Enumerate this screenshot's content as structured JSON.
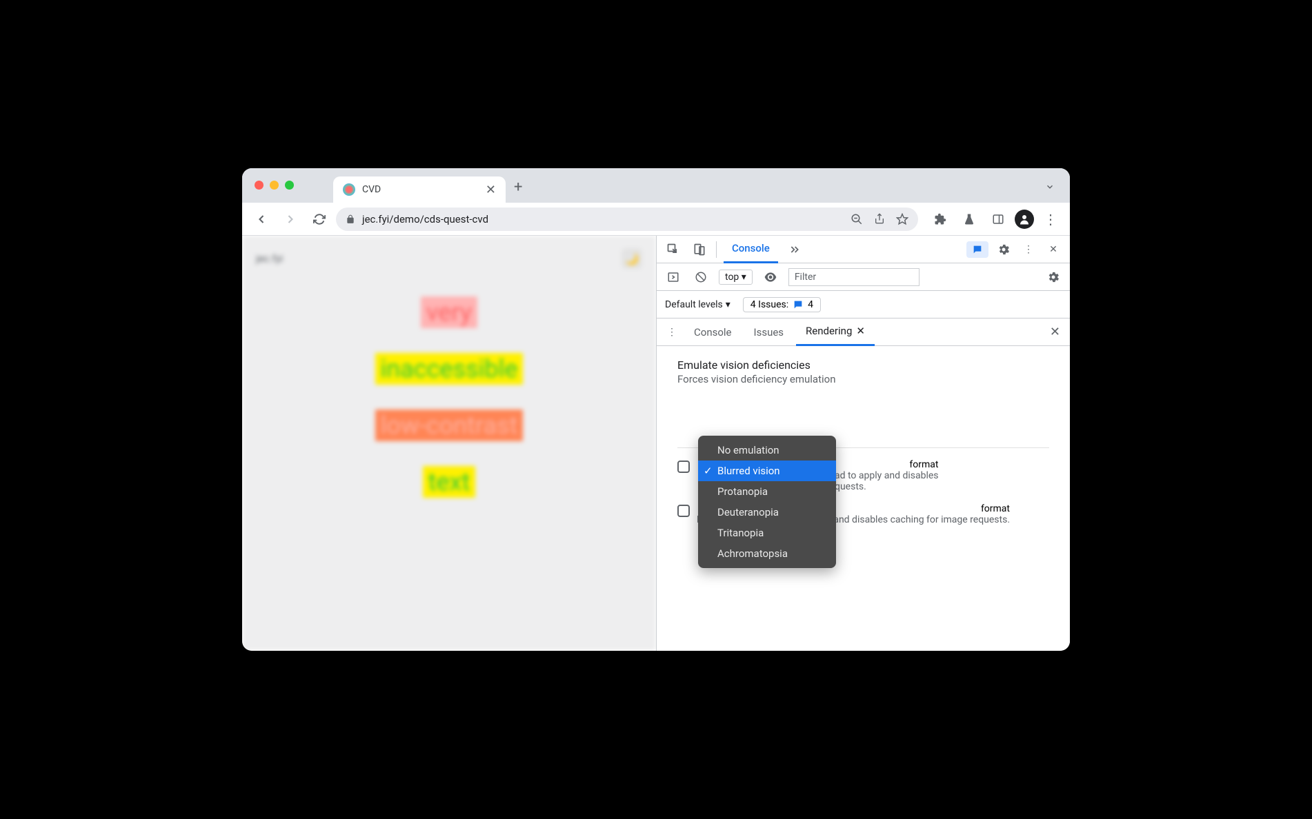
{
  "browser": {
    "tab_title": "CVD",
    "url": "jec.fyi/demo/cds-quest-cvd"
  },
  "page": {
    "site_label": "jec.fyi",
    "words": {
      "w1": "very",
      "w2": "inaccessible",
      "w3": "low-contrast",
      "w4": "text"
    }
  },
  "devtools": {
    "topbar": {
      "console_tab": "Console"
    },
    "console_bar": {
      "context": "top",
      "filter_placeholder": "Filter"
    },
    "levels_bar": {
      "levels": "Default levels",
      "issues_label": "4 Issues:",
      "issues_count": "4"
    },
    "drawer": {
      "tab_console": "Console",
      "tab_issues": "Issues",
      "tab_rendering": "Rendering"
    },
    "rendering": {
      "section_title": "Emulate vision deficiencies",
      "section_sub": "Forces vision deficiency emulation",
      "format1_title_tail": "format",
      "format1_desc_tail": "ad to apply and disables",
      "format1_desc_line2": "quests.",
      "format2_title_tail": "format",
      "format2_desc": "Requires a page reload to apply and disables caching for image requests."
    },
    "dropdown": {
      "opt0": "No emulation",
      "opt1": "Blurred vision",
      "opt2": "Protanopia",
      "opt3": "Deuteranopia",
      "opt4": "Tritanopia",
      "opt5": "Achromatopsia"
    }
  }
}
